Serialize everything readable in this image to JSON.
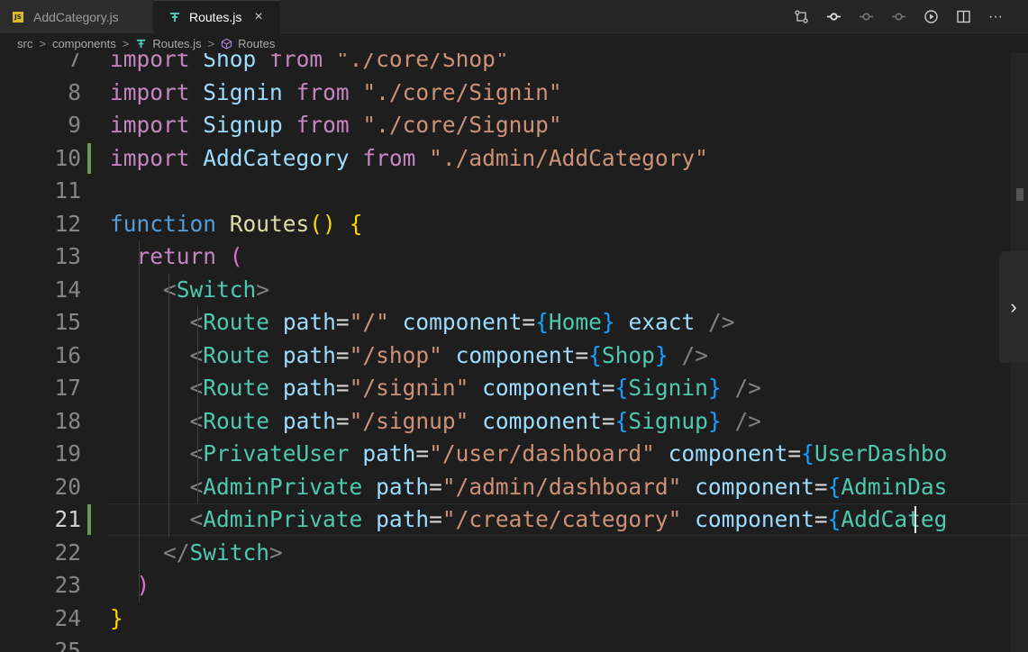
{
  "tabs": [
    {
      "label": "AddCategory.js",
      "icon": "js-file-icon"
    },
    {
      "label": "Routes.js",
      "icon": "route-file-icon",
      "close": "×"
    }
  ],
  "actions": [
    "git-compare-icon",
    "go-back-icon",
    "circle-nav-icon",
    "circle-nav-2-icon",
    "run-icon",
    "split-editor-icon",
    "more-icon"
  ],
  "more_label": "···",
  "breadcrumb": {
    "parts": [
      "src",
      "components",
      "Routes.js",
      "Routes"
    ],
    "sep": ">"
  },
  "editor": {
    "line_numbers": [
      "7",
      "8",
      "9",
      "10",
      "11",
      "12",
      "13",
      "14",
      "15",
      "16",
      "17",
      "18",
      "19",
      "20",
      "21",
      "22",
      "23",
      "24",
      "25"
    ],
    "current_line": "21",
    "lines": [
      [
        [
          "kw",
          "import"
        ],
        [
          "plain",
          " "
        ],
        [
          "id",
          "Shop"
        ],
        [
          "plain",
          " "
        ],
        [
          "kw",
          "from"
        ],
        [
          "plain",
          " "
        ],
        [
          "str",
          "\"./core/Shop\""
        ]
      ],
      [
        [
          "kw",
          "import"
        ],
        [
          "plain",
          " "
        ],
        [
          "id",
          "Signin"
        ],
        [
          "plain",
          " "
        ],
        [
          "kw",
          "from"
        ],
        [
          "plain",
          " "
        ],
        [
          "str",
          "\"./core/Signin\""
        ]
      ],
      [
        [
          "kw",
          "import"
        ],
        [
          "plain",
          " "
        ],
        [
          "id",
          "Signup"
        ],
        [
          "plain",
          " "
        ],
        [
          "kw",
          "from"
        ],
        [
          "plain",
          " "
        ],
        [
          "str",
          "\"./core/Signup\""
        ]
      ],
      [
        [
          "kw",
          "import"
        ],
        [
          "plain",
          " "
        ],
        [
          "id",
          "AddCategory"
        ],
        [
          "plain",
          " "
        ],
        [
          "kw",
          "from"
        ],
        [
          "plain",
          " "
        ],
        [
          "str",
          "\"./admin/AddCategory\""
        ]
      ],
      [],
      [
        [
          "kwb",
          "function"
        ],
        [
          "plain",
          " "
        ],
        [
          "fn",
          "Routes"
        ],
        [
          "br1",
          "()"
        ],
        [
          "plain",
          " "
        ],
        [
          "br1",
          "{"
        ]
      ],
      [
        [
          "plain",
          "  "
        ],
        [
          "kw",
          "return"
        ],
        [
          "plain",
          " "
        ],
        [
          "br2",
          "("
        ]
      ],
      [
        [
          "plain",
          "    "
        ],
        [
          "punc",
          "<"
        ],
        [
          "tag",
          "Switch"
        ],
        [
          "punc",
          ">"
        ]
      ],
      [
        [
          "plain",
          "      "
        ],
        [
          "punc",
          "<"
        ],
        [
          "tag",
          "Route"
        ],
        [
          "plain",
          " "
        ],
        [
          "id",
          "path"
        ],
        [
          "plain",
          "="
        ],
        [
          "str",
          "\"/\""
        ],
        [
          "plain",
          " "
        ],
        [
          "id",
          "component"
        ],
        [
          "plain",
          "="
        ],
        [
          "br3",
          "{"
        ],
        [
          "tag",
          "Home"
        ],
        [
          "br3",
          "}"
        ],
        [
          "plain",
          " "
        ],
        [
          "id",
          "exact"
        ],
        [
          "plain",
          " "
        ],
        [
          "punc",
          "/>"
        ]
      ],
      [
        [
          "plain",
          "      "
        ],
        [
          "punc",
          "<"
        ],
        [
          "tag",
          "Route"
        ],
        [
          "plain",
          " "
        ],
        [
          "id",
          "path"
        ],
        [
          "plain",
          "="
        ],
        [
          "str",
          "\"/shop\""
        ],
        [
          "plain",
          " "
        ],
        [
          "id",
          "component"
        ],
        [
          "plain",
          "="
        ],
        [
          "br3",
          "{"
        ],
        [
          "tag",
          "Shop"
        ],
        [
          "br3",
          "}"
        ],
        [
          "plain",
          " "
        ],
        [
          "punc",
          "/>"
        ]
      ],
      [
        [
          "plain",
          "      "
        ],
        [
          "punc",
          "<"
        ],
        [
          "tag",
          "Route"
        ],
        [
          "plain",
          " "
        ],
        [
          "id",
          "path"
        ],
        [
          "plain",
          "="
        ],
        [
          "str",
          "\"/signin\""
        ],
        [
          "plain",
          " "
        ],
        [
          "id",
          "component"
        ],
        [
          "plain",
          "="
        ],
        [
          "br3",
          "{"
        ],
        [
          "tag",
          "Signin"
        ],
        [
          "br3",
          "}"
        ],
        [
          "plain",
          " "
        ],
        [
          "punc",
          "/>"
        ]
      ],
      [
        [
          "plain",
          "      "
        ],
        [
          "punc",
          "<"
        ],
        [
          "tag",
          "Route"
        ],
        [
          "plain",
          " "
        ],
        [
          "id",
          "path"
        ],
        [
          "plain",
          "="
        ],
        [
          "str",
          "\"/signup\""
        ],
        [
          "plain",
          " "
        ],
        [
          "id",
          "component"
        ],
        [
          "plain",
          "="
        ],
        [
          "br3",
          "{"
        ],
        [
          "tag",
          "Signup"
        ],
        [
          "br3",
          "}"
        ],
        [
          "plain",
          " "
        ],
        [
          "punc",
          "/>"
        ]
      ],
      [
        [
          "plain",
          "      "
        ],
        [
          "punc",
          "<"
        ],
        [
          "tag",
          "PrivateUser"
        ],
        [
          "plain",
          " "
        ],
        [
          "id",
          "path"
        ],
        [
          "plain",
          "="
        ],
        [
          "str",
          "\"/user/dashboard\""
        ],
        [
          "plain",
          " "
        ],
        [
          "id",
          "component"
        ],
        [
          "plain",
          "="
        ],
        [
          "br3",
          "{"
        ],
        [
          "tag",
          "UserDashbo"
        ]
      ],
      [
        [
          "plain",
          "      "
        ],
        [
          "punc",
          "<"
        ],
        [
          "tag",
          "AdminPrivate"
        ],
        [
          "plain",
          " "
        ],
        [
          "id",
          "path"
        ],
        [
          "plain",
          "="
        ],
        [
          "str",
          "\"/admin/dashboard\""
        ],
        [
          "plain",
          " "
        ],
        [
          "id",
          "component"
        ],
        [
          "plain",
          "="
        ],
        [
          "br3",
          "{"
        ],
        [
          "tag",
          "AdminDas"
        ]
      ],
      [
        [
          "plain",
          "      "
        ],
        [
          "punc",
          "<"
        ],
        [
          "tag",
          "AdminPrivate"
        ],
        [
          "plain",
          " "
        ],
        [
          "id",
          "path"
        ],
        [
          "plain",
          "="
        ],
        [
          "str",
          "\"/create/category\""
        ],
        [
          "plain",
          " "
        ],
        [
          "id",
          "component"
        ],
        [
          "plain",
          "="
        ],
        [
          "br3",
          "{"
        ],
        [
          "tag",
          "AddCateg"
        ]
      ],
      [
        [
          "plain",
          "    "
        ],
        [
          "punc",
          "</"
        ],
        [
          "tag",
          "Switch"
        ],
        [
          "punc",
          ">"
        ]
      ],
      [
        [
          "plain",
          "  "
        ],
        [
          "br2",
          ")"
        ]
      ],
      [
        [
          "br1",
          "}"
        ]
      ],
      []
    ],
    "modified_lines": [
      "10",
      "21"
    ]
  },
  "collapse_label": "›"
}
